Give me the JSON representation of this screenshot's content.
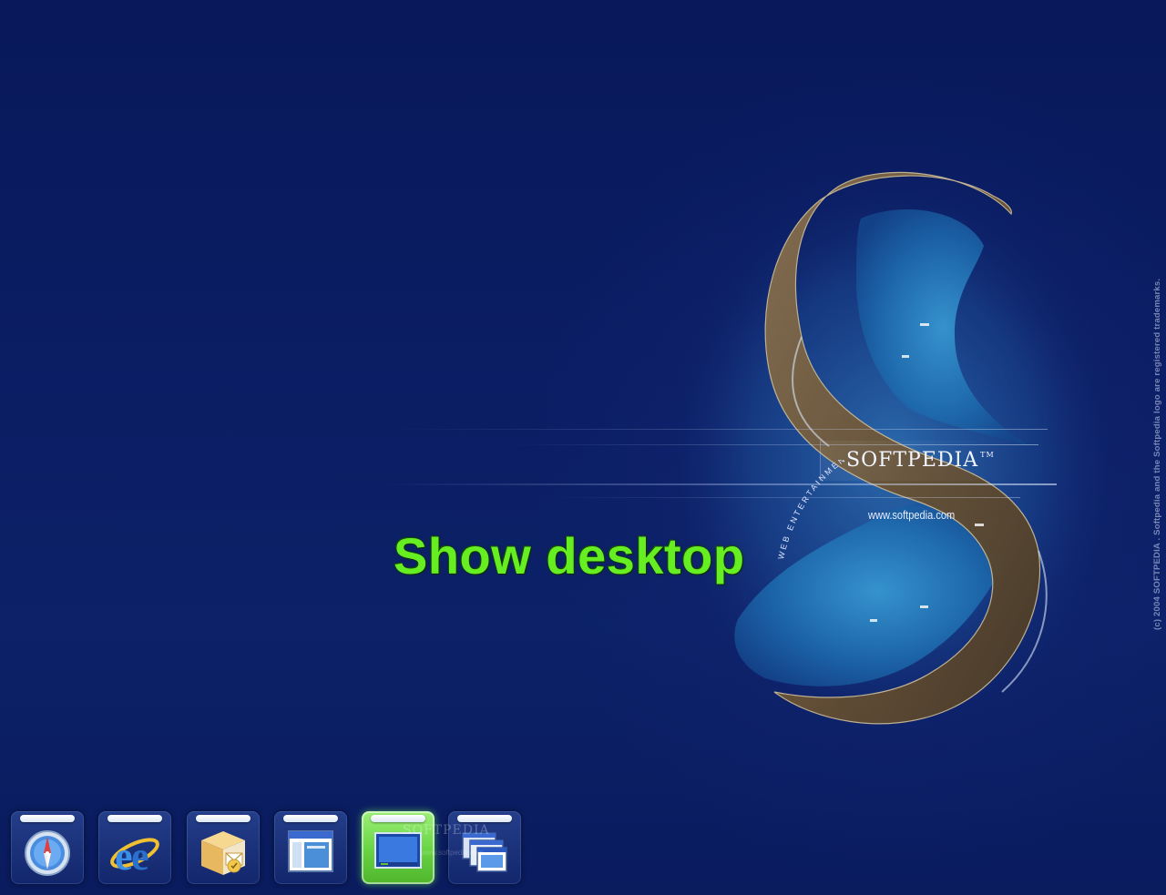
{
  "desktop": {
    "wallpaper": {
      "brand": "SOFTPEDIA",
      "trademark": "TM",
      "url": "www.softpedia.com",
      "tagline": "WEB ENTERTAINMENT",
      "copyright": "(c) 2004 SOFTPEDIA . Softpedia and the Softpedia logo are registered trademarks."
    },
    "hover_label": "Show desktop"
  },
  "dock": {
    "items": [
      {
        "name": "Safari",
        "icon": "compass-icon",
        "active": false
      },
      {
        "name": "Internet Explorer",
        "icon": "internet-explorer-icon",
        "active": false
      },
      {
        "name": "Outlook",
        "icon": "mail-box-icon",
        "active": false
      },
      {
        "name": "Window",
        "icon": "window-icon",
        "active": false
      },
      {
        "name": "Show desktop",
        "icon": "show-desktop-icon",
        "active": true
      },
      {
        "name": "Switch windows",
        "icon": "multiple-windows-icon",
        "active": false
      }
    ],
    "watermark": "SOFTPEDIA",
    "watermark_url": "www.softpedia.com"
  },
  "colors": {
    "background": "#0b1d63",
    "label_green": "#66ee22",
    "active_tile": "#6bd645"
  }
}
